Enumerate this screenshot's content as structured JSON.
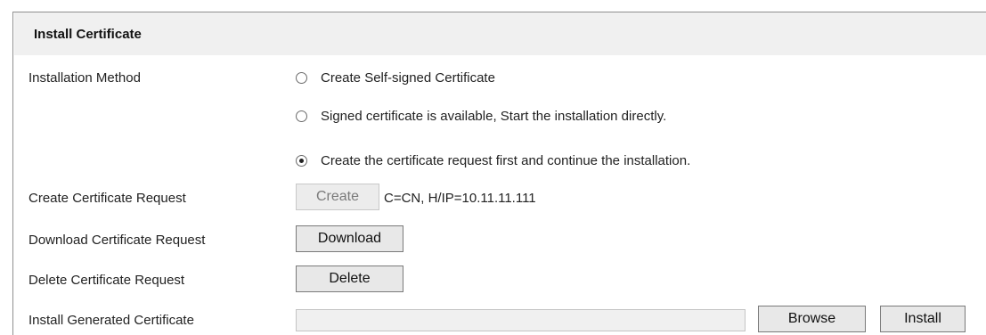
{
  "section": {
    "title": "Install Certificate"
  },
  "installation_method": {
    "label": "Installation Method",
    "options": [
      {
        "label": "Create Self-signed Certificate",
        "checked": false
      },
      {
        "label": "Signed certificate is available, Start the installation directly.",
        "checked": false
      },
      {
        "label": "Create the certificate request first and continue the installation.",
        "checked": true
      }
    ]
  },
  "create_request": {
    "label": "Create Certificate Request",
    "button": "Create",
    "button_disabled": true,
    "info": "C=CN, H/IP=10.11.11.111"
  },
  "download_request": {
    "label": "Download Certificate Request",
    "button": "Download"
  },
  "delete_request": {
    "label": "Delete Certificate Request",
    "button": "Delete"
  },
  "install_generated": {
    "label": "Install Generated Certificate",
    "file_value": "",
    "browse_button": "Browse",
    "install_button": "Install"
  }
}
